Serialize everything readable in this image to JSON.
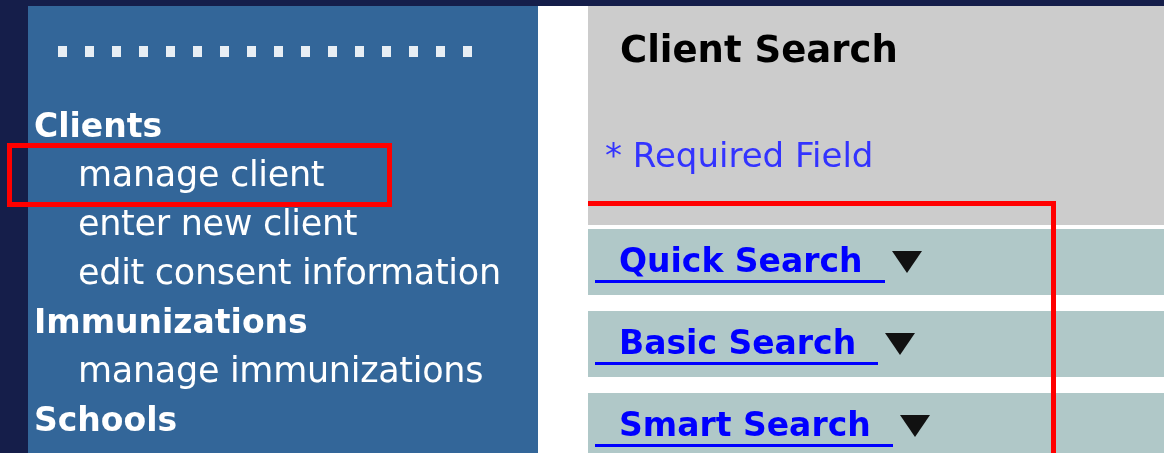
{
  "sidebar": {
    "sections": [
      {
        "heading": "Clients",
        "items": [
          {
            "label": "manage client",
            "highlighted": true
          },
          {
            "label": "enter new client",
            "highlighted": false
          },
          {
            "label": "edit consent information",
            "highlighted": false
          }
        ]
      },
      {
        "heading": "Immunizations",
        "items": [
          {
            "label": "manage immunizations",
            "highlighted": false
          }
        ]
      },
      {
        "heading": "Schools"
      }
    ]
  },
  "main": {
    "title": "Client Search",
    "required_note": "* Required Field",
    "search_sections": {
      "highlighted": true,
      "items": [
        {
          "label": "Quick Search",
          "expanded": false
        },
        {
          "label": "Basic Search",
          "expanded": false
        },
        {
          "label": "Smart Search",
          "expanded": false
        }
      ]
    }
  }
}
